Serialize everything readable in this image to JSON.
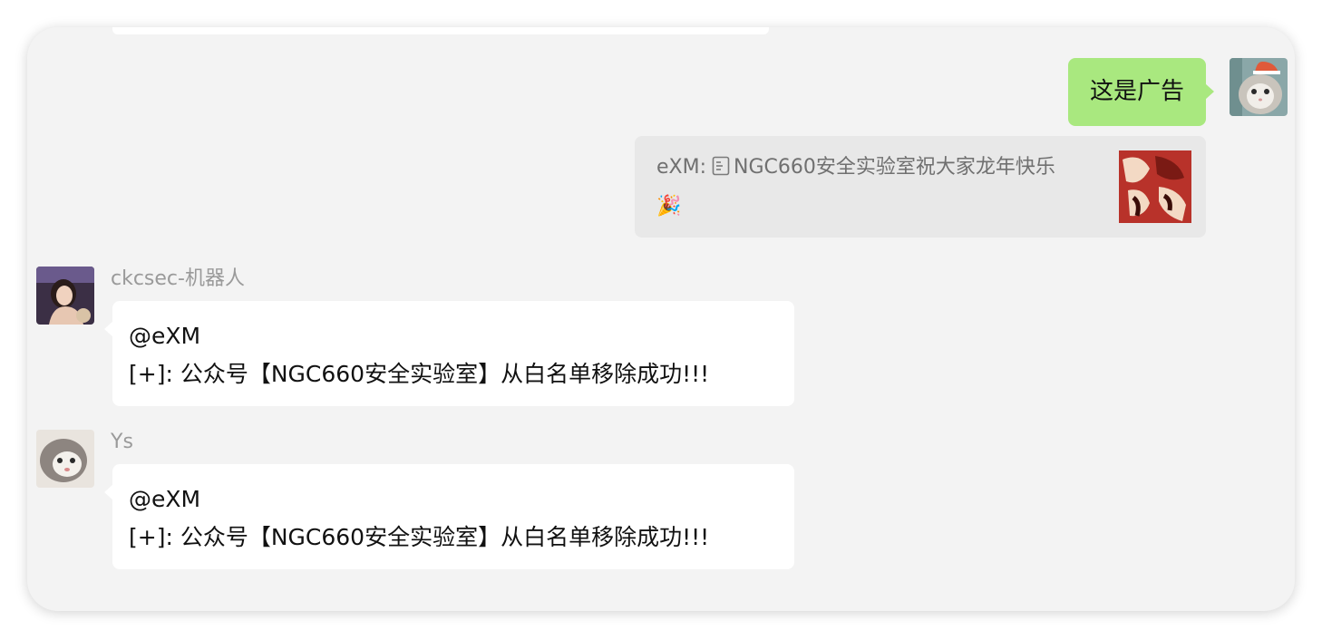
{
  "messages": {
    "outgoing": {
      "text": "这是广告"
    },
    "quote": {
      "sender": "eXM:",
      "title": "NGC660安全实验室祝大家龙年快乐",
      "doc_icon": "document-icon",
      "emoji": "🎉"
    },
    "bot": {
      "sender": "ckcsec-机器人",
      "mention": "@eXM",
      "body": "[+]: 公众号【NGC660安全实验室】从白名单移除成功!!!"
    },
    "ys": {
      "sender": "Ys",
      "mention": "@eXM",
      "body": "[+]: 公众号【NGC660安全实验室】从白名单移除成功!!!"
    }
  },
  "colors": {
    "outgoing_bubble": "#a9e87f",
    "incoming_bubble": "#ffffff",
    "quote_card": "#e8e8e8",
    "chat_background": "#f3f3f3"
  }
}
